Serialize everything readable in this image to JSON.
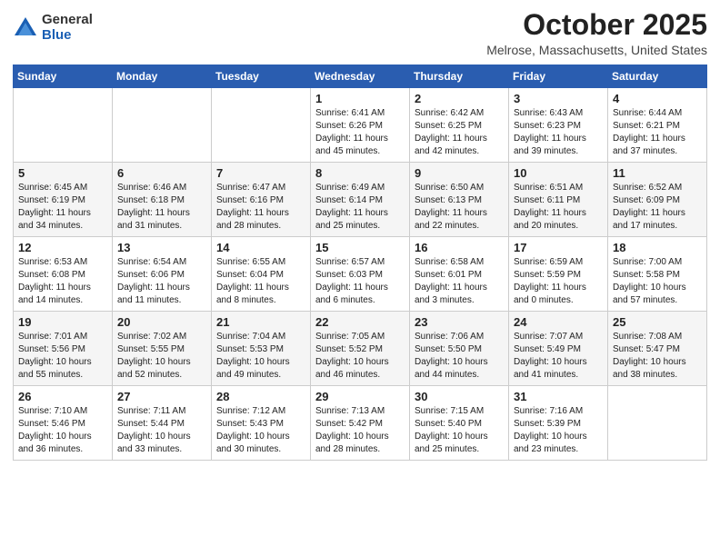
{
  "logo": {
    "general": "General",
    "blue": "Blue"
  },
  "header": {
    "month": "October 2025",
    "location": "Melrose, Massachusetts, United States"
  },
  "days_of_week": [
    "Sunday",
    "Monday",
    "Tuesday",
    "Wednesday",
    "Thursday",
    "Friday",
    "Saturday"
  ],
  "weeks": [
    [
      {
        "day": "",
        "info": ""
      },
      {
        "day": "",
        "info": ""
      },
      {
        "day": "",
        "info": ""
      },
      {
        "day": "1",
        "info": "Sunrise: 6:41 AM\nSunset: 6:26 PM\nDaylight: 11 hours\nand 45 minutes."
      },
      {
        "day": "2",
        "info": "Sunrise: 6:42 AM\nSunset: 6:25 PM\nDaylight: 11 hours\nand 42 minutes."
      },
      {
        "day": "3",
        "info": "Sunrise: 6:43 AM\nSunset: 6:23 PM\nDaylight: 11 hours\nand 39 minutes."
      },
      {
        "day": "4",
        "info": "Sunrise: 6:44 AM\nSunset: 6:21 PM\nDaylight: 11 hours\nand 37 minutes."
      }
    ],
    [
      {
        "day": "5",
        "info": "Sunrise: 6:45 AM\nSunset: 6:19 PM\nDaylight: 11 hours\nand 34 minutes."
      },
      {
        "day": "6",
        "info": "Sunrise: 6:46 AM\nSunset: 6:18 PM\nDaylight: 11 hours\nand 31 minutes."
      },
      {
        "day": "7",
        "info": "Sunrise: 6:47 AM\nSunset: 6:16 PM\nDaylight: 11 hours\nand 28 minutes."
      },
      {
        "day": "8",
        "info": "Sunrise: 6:49 AM\nSunset: 6:14 PM\nDaylight: 11 hours\nand 25 minutes."
      },
      {
        "day": "9",
        "info": "Sunrise: 6:50 AM\nSunset: 6:13 PM\nDaylight: 11 hours\nand 22 minutes."
      },
      {
        "day": "10",
        "info": "Sunrise: 6:51 AM\nSunset: 6:11 PM\nDaylight: 11 hours\nand 20 minutes."
      },
      {
        "day": "11",
        "info": "Sunrise: 6:52 AM\nSunset: 6:09 PM\nDaylight: 11 hours\nand 17 minutes."
      }
    ],
    [
      {
        "day": "12",
        "info": "Sunrise: 6:53 AM\nSunset: 6:08 PM\nDaylight: 11 hours\nand 14 minutes."
      },
      {
        "day": "13",
        "info": "Sunrise: 6:54 AM\nSunset: 6:06 PM\nDaylight: 11 hours\nand 11 minutes."
      },
      {
        "day": "14",
        "info": "Sunrise: 6:55 AM\nSunset: 6:04 PM\nDaylight: 11 hours\nand 8 minutes."
      },
      {
        "day": "15",
        "info": "Sunrise: 6:57 AM\nSunset: 6:03 PM\nDaylight: 11 hours\nand 6 minutes."
      },
      {
        "day": "16",
        "info": "Sunrise: 6:58 AM\nSunset: 6:01 PM\nDaylight: 11 hours\nand 3 minutes."
      },
      {
        "day": "17",
        "info": "Sunrise: 6:59 AM\nSunset: 5:59 PM\nDaylight: 11 hours\nand 0 minutes."
      },
      {
        "day": "18",
        "info": "Sunrise: 7:00 AM\nSunset: 5:58 PM\nDaylight: 10 hours\nand 57 minutes."
      }
    ],
    [
      {
        "day": "19",
        "info": "Sunrise: 7:01 AM\nSunset: 5:56 PM\nDaylight: 10 hours\nand 55 minutes."
      },
      {
        "day": "20",
        "info": "Sunrise: 7:02 AM\nSunset: 5:55 PM\nDaylight: 10 hours\nand 52 minutes."
      },
      {
        "day": "21",
        "info": "Sunrise: 7:04 AM\nSunset: 5:53 PM\nDaylight: 10 hours\nand 49 minutes."
      },
      {
        "day": "22",
        "info": "Sunrise: 7:05 AM\nSunset: 5:52 PM\nDaylight: 10 hours\nand 46 minutes."
      },
      {
        "day": "23",
        "info": "Sunrise: 7:06 AM\nSunset: 5:50 PM\nDaylight: 10 hours\nand 44 minutes."
      },
      {
        "day": "24",
        "info": "Sunrise: 7:07 AM\nSunset: 5:49 PM\nDaylight: 10 hours\nand 41 minutes."
      },
      {
        "day": "25",
        "info": "Sunrise: 7:08 AM\nSunset: 5:47 PM\nDaylight: 10 hours\nand 38 minutes."
      }
    ],
    [
      {
        "day": "26",
        "info": "Sunrise: 7:10 AM\nSunset: 5:46 PM\nDaylight: 10 hours\nand 36 minutes."
      },
      {
        "day": "27",
        "info": "Sunrise: 7:11 AM\nSunset: 5:44 PM\nDaylight: 10 hours\nand 33 minutes."
      },
      {
        "day": "28",
        "info": "Sunrise: 7:12 AM\nSunset: 5:43 PM\nDaylight: 10 hours\nand 30 minutes."
      },
      {
        "day": "29",
        "info": "Sunrise: 7:13 AM\nSunset: 5:42 PM\nDaylight: 10 hours\nand 28 minutes."
      },
      {
        "day": "30",
        "info": "Sunrise: 7:15 AM\nSunset: 5:40 PM\nDaylight: 10 hours\nand 25 minutes."
      },
      {
        "day": "31",
        "info": "Sunrise: 7:16 AM\nSunset: 5:39 PM\nDaylight: 10 hours\nand 23 minutes."
      },
      {
        "day": "",
        "info": ""
      }
    ]
  ]
}
